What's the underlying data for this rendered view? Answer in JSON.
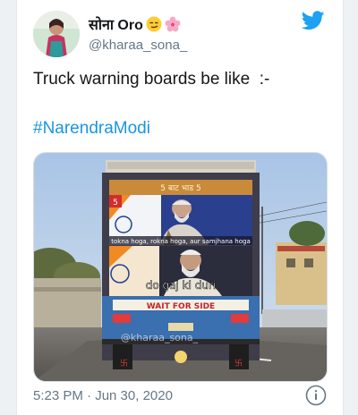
{
  "tweet": {
    "display_name": "सोना Oro",
    "handle": "@kharaa_sona_",
    "text": "Truck warning boards be like  :-",
    "hashtag": "#NarendraModi",
    "timestamp": "5:23 PM · Jun 30, 2020"
  },
  "media": {
    "caption_top": "tokna hoga, rokna hoga, aur samjhana hoga",
    "caption_bottom": "do gaj ki duri",
    "truck_board": "WAIT FOR SIDE",
    "watermark": "@kharaa_sona_",
    "top_board_text": "5 बाट भाड 5",
    "channel_badge": "5"
  },
  "icons": {
    "emoji_1": "smirk-face-emoji",
    "emoji_2": "cherry-blossom-emoji",
    "logo": "twitter-bird-icon",
    "info": "info-icon"
  },
  "colors": {
    "handle": "#657786",
    "hashtag": "#1b95e0",
    "twitter_blue": "#1da1f2"
  }
}
